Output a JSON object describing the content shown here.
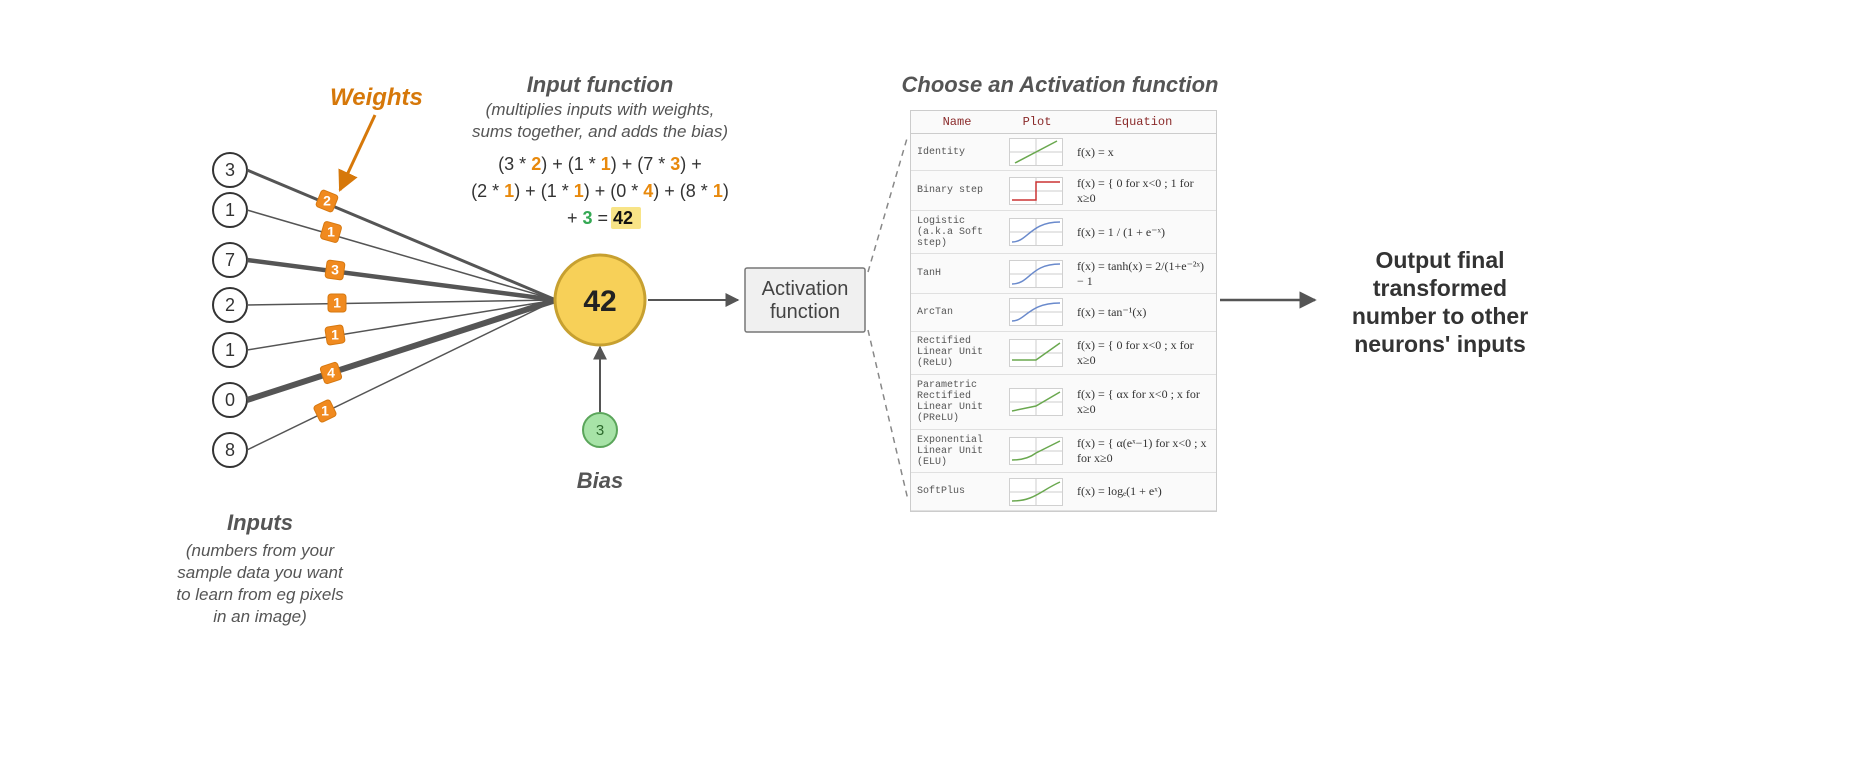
{
  "inputs_label": {
    "title": "Inputs",
    "sub1": "(numbers from your",
    "sub2": "sample data you want",
    "sub3": "to learn from eg pixels",
    "sub4": "in an image)"
  },
  "weights_label": "Weights",
  "inputfn": {
    "title": "Input function",
    "sub1": "(multiplies inputs with weights,",
    "sub2": "sums together, and adds the bias)"
  },
  "formula": {
    "l1a": "(3 * ",
    "w1": "2",
    "l1b": ") + (1 * ",
    "w2": "1",
    "l1c": ") + (7 * ",
    "w3": "3",
    "l1d": ") +",
    "l2a": "(2 * ",
    "w4": "1",
    "l2b": ") + (1 * ",
    "w5": "1",
    "l2c": ") + (0 * ",
    "w6": "4",
    "l2d": ") + (8 * ",
    "w7": "1",
    "l2e": ")",
    "l3a": "+ ",
    "bias": "3",
    "l3b": " = ",
    "result": "42"
  },
  "inputs": {
    "v0": "3",
    "v1": "1",
    "v2": "7",
    "v3": "2",
    "v4": "1",
    "v5": "0",
    "v6": "8"
  },
  "weights": {
    "w0": "2",
    "w1": "1",
    "w2": "3",
    "w3": "1",
    "w4": "1",
    "w5": "4",
    "w6": "1"
  },
  "neuron_value": "42",
  "bias_value": "3",
  "bias_label": "Bias",
  "activation_box": {
    "l1": "Activation",
    "l2": "function"
  },
  "activation_title": "Choose an Activation function",
  "act_headers": {
    "name": "Name",
    "plot": "Plot",
    "eq": "Equation"
  },
  "act_rows": {
    "r0": {
      "name": "Identity",
      "eq": "f(x) = x"
    },
    "r1": {
      "name": "Binary step",
      "eq": "f(x) = { 0 for x<0 ; 1 for x≥0"
    },
    "r2": {
      "name": "Logistic (a.k.a Soft step)",
      "eq": "f(x) = 1 / (1 + e⁻ˣ)"
    },
    "r3": {
      "name": "TanH",
      "eq": "f(x) = tanh(x) = 2/(1+e⁻²ˣ) − 1"
    },
    "r4": {
      "name": "ArcTan",
      "eq": "f(x) = tan⁻¹(x)"
    },
    "r5": {
      "name": "Rectified Linear Unit (ReLU)",
      "eq": "f(x) = { 0 for x<0 ; x for x≥0"
    },
    "r6": {
      "name": "Parametric Rectified Linear Unit (PReLU)",
      "eq": "f(x) = { αx for x<0 ; x for x≥0"
    },
    "r7": {
      "name": "Exponential Linear Unit (ELU)",
      "eq": "f(x) = { α(eˣ−1) for x<0 ; x for x≥0"
    },
    "r8": {
      "name": "SoftPlus",
      "eq": "f(x) = logₑ(1 + eˣ)"
    }
  },
  "output": {
    "l1": "Output final",
    "l2": "transformed",
    "l3": "number to other",
    "l4": "neurons' inputs"
  },
  "chart_data": {
    "type": "diagram",
    "inputs": [
      3,
      1,
      7,
      2,
      1,
      0,
      8
    ],
    "weights": [
      2,
      1,
      3,
      1,
      1,
      4,
      1
    ],
    "bias": 3,
    "weighted_sum": 42,
    "activation_functions": [
      {
        "name": "Identity",
        "equation": "f(x)=x"
      },
      {
        "name": "Binary step",
        "equation": "f(x)=0 for x<0, 1 for x>=0"
      },
      {
        "name": "Logistic (Soft step)",
        "equation": "f(x)=1/(1+e^-x)"
      },
      {
        "name": "TanH",
        "equation": "f(x)=tanh(x)=2/(1+e^-2x)-1"
      },
      {
        "name": "ArcTan",
        "equation": "f(x)=arctan(x)"
      },
      {
        "name": "Rectified Linear Unit (ReLU)",
        "equation": "f(x)=0 for x<0, x for x>=0"
      },
      {
        "name": "Parametric Rectified Linear Unit (PReLU)",
        "equation": "f(x)=alpha*x for x<0, x for x>=0"
      },
      {
        "name": "Exponential Linear Unit (ELU)",
        "equation": "f(x)=alpha*(e^x-1) for x<0, x for x>=0"
      },
      {
        "name": "SoftPlus",
        "equation": "f(x)=ln(1+e^x)"
      }
    ]
  }
}
